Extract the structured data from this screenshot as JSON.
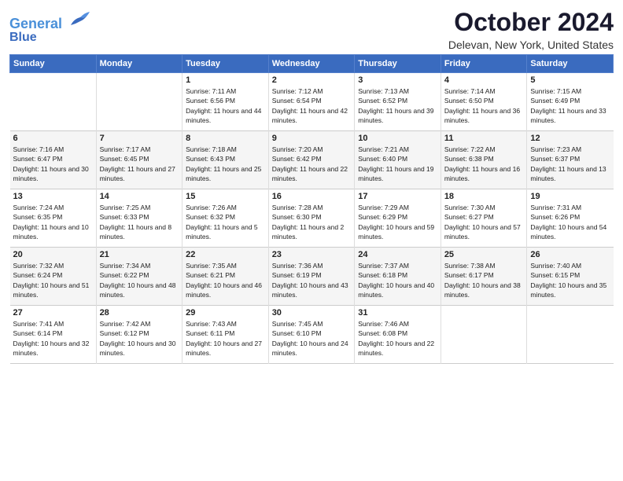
{
  "header": {
    "logo_line1": "General",
    "logo_line2": "Blue",
    "month": "October 2024",
    "location": "Delevan, New York, United States"
  },
  "weekdays": [
    "Sunday",
    "Monday",
    "Tuesday",
    "Wednesday",
    "Thursday",
    "Friday",
    "Saturday"
  ],
  "weeks": [
    [
      {
        "num": "",
        "info": ""
      },
      {
        "num": "",
        "info": ""
      },
      {
        "num": "1",
        "info": "Sunrise: 7:11 AM\nSunset: 6:56 PM\nDaylight: 11 hours and 44 minutes."
      },
      {
        "num": "2",
        "info": "Sunrise: 7:12 AM\nSunset: 6:54 PM\nDaylight: 11 hours and 42 minutes."
      },
      {
        "num": "3",
        "info": "Sunrise: 7:13 AM\nSunset: 6:52 PM\nDaylight: 11 hours and 39 minutes."
      },
      {
        "num": "4",
        "info": "Sunrise: 7:14 AM\nSunset: 6:50 PM\nDaylight: 11 hours and 36 minutes."
      },
      {
        "num": "5",
        "info": "Sunrise: 7:15 AM\nSunset: 6:49 PM\nDaylight: 11 hours and 33 minutes."
      }
    ],
    [
      {
        "num": "6",
        "info": "Sunrise: 7:16 AM\nSunset: 6:47 PM\nDaylight: 11 hours and 30 minutes."
      },
      {
        "num": "7",
        "info": "Sunrise: 7:17 AM\nSunset: 6:45 PM\nDaylight: 11 hours and 27 minutes."
      },
      {
        "num": "8",
        "info": "Sunrise: 7:18 AM\nSunset: 6:43 PM\nDaylight: 11 hours and 25 minutes."
      },
      {
        "num": "9",
        "info": "Sunrise: 7:20 AM\nSunset: 6:42 PM\nDaylight: 11 hours and 22 minutes."
      },
      {
        "num": "10",
        "info": "Sunrise: 7:21 AM\nSunset: 6:40 PM\nDaylight: 11 hours and 19 minutes."
      },
      {
        "num": "11",
        "info": "Sunrise: 7:22 AM\nSunset: 6:38 PM\nDaylight: 11 hours and 16 minutes."
      },
      {
        "num": "12",
        "info": "Sunrise: 7:23 AM\nSunset: 6:37 PM\nDaylight: 11 hours and 13 minutes."
      }
    ],
    [
      {
        "num": "13",
        "info": "Sunrise: 7:24 AM\nSunset: 6:35 PM\nDaylight: 11 hours and 10 minutes."
      },
      {
        "num": "14",
        "info": "Sunrise: 7:25 AM\nSunset: 6:33 PM\nDaylight: 11 hours and 8 minutes."
      },
      {
        "num": "15",
        "info": "Sunrise: 7:26 AM\nSunset: 6:32 PM\nDaylight: 11 hours and 5 minutes."
      },
      {
        "num": "16",
        "info": "Sunrise: 7:28 AM\nSunset: 6:30 PM\nDaylight: 11 hours and 2 minutes."
      },
      {
        "num": "17",
        "info": "Sunrise: 7:29 AM\nSunset: 6:29 PM\nDaylight: 10 hours and 59 minutes."
      },
      {
        "num": "18",
        "info": "Sunrise: 7:30 AM\nSunset: 6:27 PM\nDaylight: 10 hours and 57 minutes."
      },
      {
        "num": "19",
        "info": "Sunrise: 7:31 AM\nSunset: 6:26 PM\nDaylight: 10 hours and 54 minutes."
      }
    ],
    [
      {
        "num": "20",
        "info": "Sunrise: 7:32 AM\nSunset: 6:24 PM\nDaylight: 10 hours and 51 minutes."
      },
      {
        "num": "21",
        "info": "Sunrise: 7:34 AM\nSunset: 6:22 PM\nDaylight: 10 hours and 48 minutes."
      },
      {
        "num": "22",
        "info": "Sunrise: 7:35 AM\nSunset: 6:21 PM\nDaylight: 10 hours and 46 minutes."
      },
      {
        "num": "23",
        "info": "Sunrise: 7:36 AM\nSunset: 6:19 PM\nDaylight: 10 hours and 43 minutes."
      },
      {
        "num": "24",
        "info": "Sunrise: 7:37 AM\nSunset: 6:18 PM\nDaylight: 10 hours and 40 minutes."
      },
      {
        "num": "25",
        "info": "Sunrise: 7:38 AM\nSunset: 6:17 PM\nDaylight: 10 hours and 38 minutes."
      },
      {
        "num": "26",
        "info": "Sunrise: 7:40 AM\nSunset: 6:15 PM\nDaylight: 10 hours and 35 minutes."
      }
    ],
    [
      {
        "num": "27",
        "info": "Sunrise: 7:41 AM\nSunset: 6:14 PM\nDaylight: 10 hours and 32 minutes."
      },
      {
        "num": "28",
        "info": "Sunrise: 7:42 AM\nSunset: 6:12 PM\nDaylight: 10 hours and 30 minutes."
      },
      {
        "num": "29",
        "info": "Sunrise: 7:43 AM\nSunset: 6:11 PM\nDaylight: 10 hours and 27 minutes."
      },
      {
        "num": "30",
        "info": "Sunrise: 7:45 AM\nSunset: 6:10 PM\nDaylight: 10 hours and 24 minutes."
      },
      {
        "num": "31",
        "info": "Sunrise: 7:46 AM\nSunset: 6:08 PM\nDaylight: 10 hours and 22 minutes."
      },
      {
        "num": "",
        "info": ""
      },
      {
        "num": "",
        "info": ""
      }
    ]
  ]
}
